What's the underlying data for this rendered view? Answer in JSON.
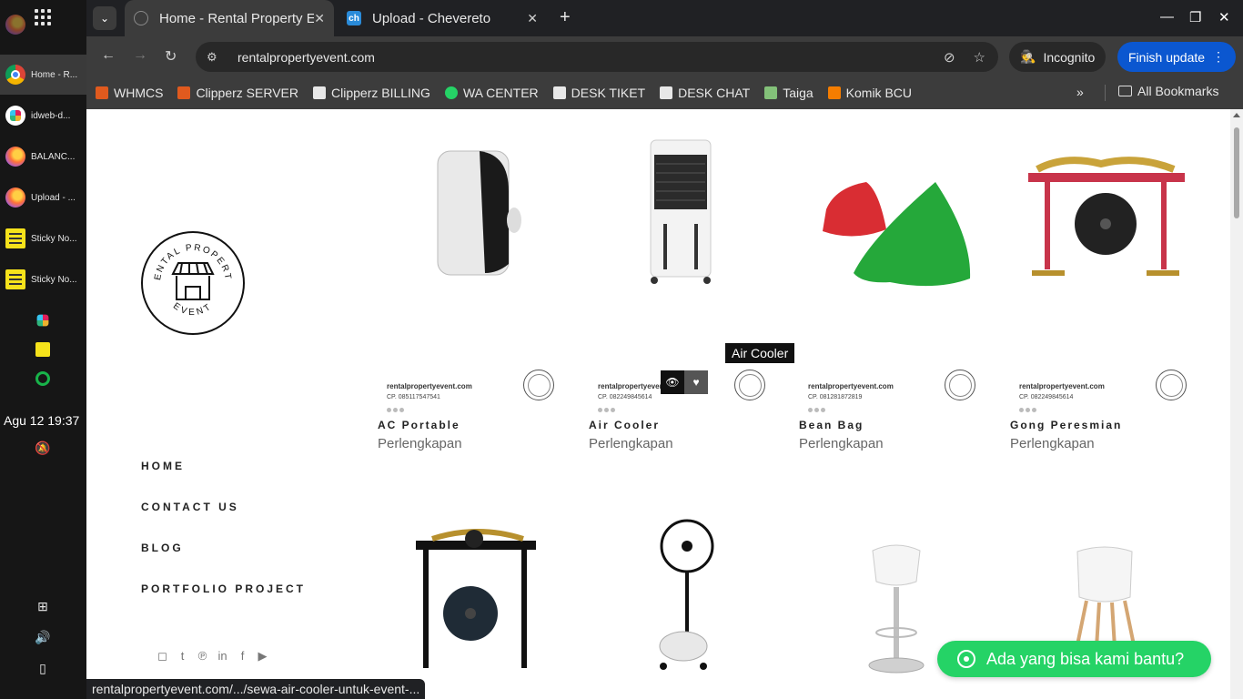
{
  "taskbar": {
    "items": [
      {
        "label": "Home - R...",
        "icon": "chrome-icon"
      },
      {
        "label": "idweb-d...",
        "icon": "slack-icon"
      },
      {
        "label": "BALANC...",
        "icon": "firefox-icon"
      },
      {
        "label": "Upload - ...",
        "icon": "firefox-icon"
      },
      {
        "label": "Sticky No...",
        "icon": "sticky-notes-icon"
      },
      {
        "label": "Sticky No...",
        "icon": "sticky-notes-icon"
      }
    ],
    "clock": "Agu 12  19:37"
  },
  "tabs": [
    {
      "title": "Home - Rental Property E",
      "active": true
    },
    {
      "title": "Upload - Chevereto",
      "active": false
    }
  ],
  "address": {
    "url": "rentalpropertyevent.com"
  },
  "incognito_label": "Incognito",
  "finish_update_label": "Finish update",
  "bookmarks": [
    {
      "label": "WHMCS",
      "color": "#e05a1e"
    },
    {
      "label": "Clipperz SERVER",
      "color": "#e05a1e"
    },
    {
      "label": "Clipperz BILLING",
      "color": "#e8e8e8"
    },
    {
      "label": "WA CENTER",
      "color": "#25d366"
    },
    {
      "label": "DESK TIKET",
      "color": "#e8e8e8"
    },
    {
      "label": "DESK CHAT",
      "color": "#e8e8e8"
    },
    {
      "label": "Taiga",
      "color": "#83c179"
    },
    {
      "label": "Komik BCU",
      "color": "#f57d00"
    }
  ],
  "all_bookmarks_label": "All Bookmarks",
  "site": {
    "logo_text_top": "RENTAL PROPERTY",
    "logo_text_bottom": "EVENT",
    "nav": [
      "HOME",
      "CONTACT US",
      "BLOG",
      "PORTFOLIO PROJECT"
    ]
  },
  "products": [
    {
      "title": "AC Portable",
      "category": "Perlengkapan",
      "wm_site": "rentalpropertyevent.com",
      "wm_cp": "CP.  085117547541"
    },
    {
      "title": "Air Cooler",
      "category": "Perlengkapan",
      "wm_site": "rentalpropertyevent.com",
      "wm_cp": "CP.  082249845614"
    },
    {
      "title": "Bean Bag",
      "category": "Perlengkapan",
      "wm_site": "rentalpropertyevent.com",
      "wm_cp": "CP.  081281872819"
    },
    {
      "title": "Gong Peresmian",
      "category": "Perlengkapan",
      "wm_site": "rentalpropertyevent.com",
      "wm_cp": "CP.  082249845614"
    }
  ],
  "tooltip": "Air Cooler",
  "chat_label": "Ada yang bisa kami bantu?",
  "status_url": "rentalpropertyevent.com/.../sewa-air-cooler-untuk-event-..."
}
